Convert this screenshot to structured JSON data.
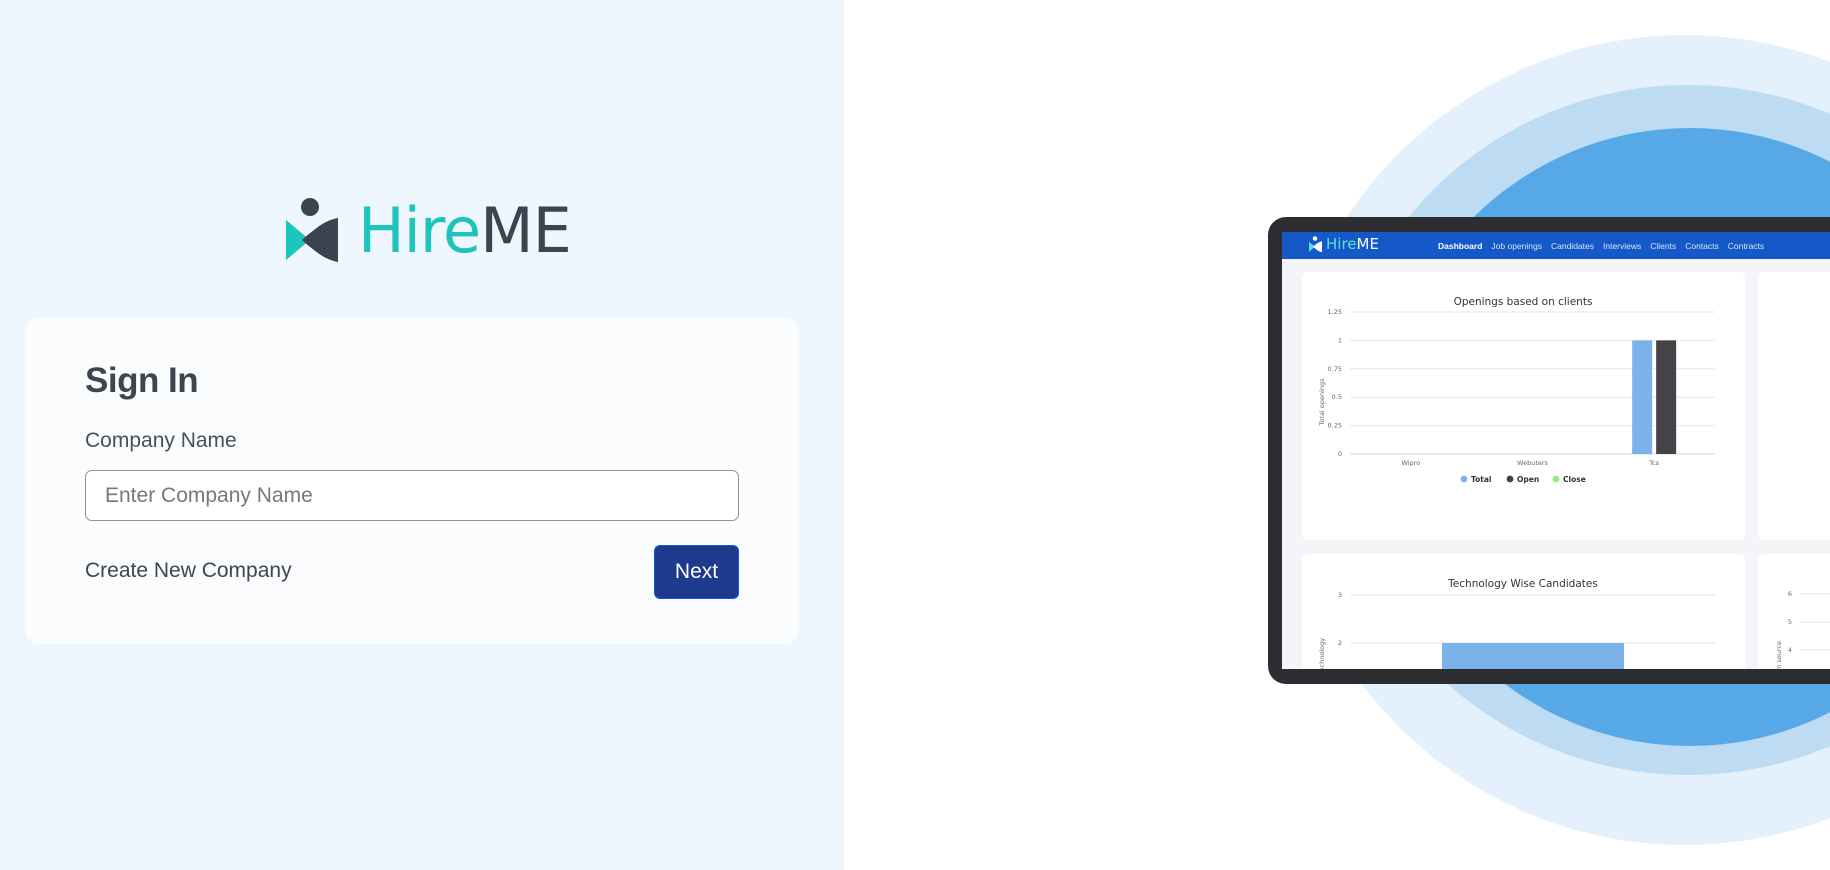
{
  "brand": {
    "hire": "Hire",
    "me": "ME"
  },
  "signin": {
    "title": "Sign In",
    "company_label": "Company Name",
    "company_placeholder": "Enter Company Name",
    "company_value": "",
    "create_link": "Create New Company",
    "next_button": "Next"
  },
  "colors": {
    "left_background": "#eef6fe",
    "primary_button": "#1e3a8f",
    "brand_teal": "#1cc4b9",
    "brand_dark": "#3d4451",
    "preview_nav": "#1558c8"
  },
  "preview": {
    "logo_hire": "Hire",
    "logo_me": "ME",
    "nav": [
      {
        "label": "Dashboard",
        "active": true
      },
      {
        "label": "Job openings",
        "active": false
      },
      {
        "label": "Candidates",
        "active": false
      },
      {
        "label": "Interviews",
        "active": false
      },
      {
        "label": "Clients",
        "active": false
      },
      {
        "label": "Contacts",
        "active": false
      },
      {
        "label": "Contracts",
        "active": false
      }
    ],
    "chart_openings": {
      "title": "Openings based on clients",
      "ylabel": "Total openings",
      "yticks": [
        "0",
        "0.25",
        "0.5",
        "0.75",
        "1",
        "1.25"
      ],
      "categories": [
        "Wipro",
        "Webuters",
        "Tcs"
      ],
      "legend": [
        "Total",
        "Open",
        "Close"
      ]
    },
    "chart_technology": {
      "title": "Technology Wise Candidates",
      "ylabel": "technology",
      "yticks": [
        "2",
        "3"
      ]
    },
    "chart_source": {
      "ylabel": "om source",
      "yticks": [
        "4",
        "5",
        "6"
      ]
    }
  },
  "chart_data": [
    {
      "type": "bar",
      "title": "Openings based on clients",
      "xlabel": "",
      "ylabel": "Total openings",
      "categories": [
        "Wipro",
        "Webuters",
        "Tcs"
      ],
      "series": [
        {
          "name": "Total",
          "values": [
            0,
            0,
            1
          ],
          "color": "#7cb2ea"
        },
        {
          "name": "Open",
          "values": [
            0,
            0,
            1
          ],
          "color": "#434348"
        },
        {
          "name": "Close",
          "values": [
            0,
            0,
            0
          ],
          "color": "#90ed7d"
        }
      ],
      "ylim": [
        0,
        1.25
      ],
      "grid": true,
      "legend": "bottom"
    },
    {
      "type": "bar",
      "title": "Technology Wise Candidates",
      "ylabel": "technology",
      "ylim": [
        1.8,
        3
      ],
      "series": [
        {
          "values": [
            2
          ]
        }
      ],
      "grid": true
    }
  ]
}
